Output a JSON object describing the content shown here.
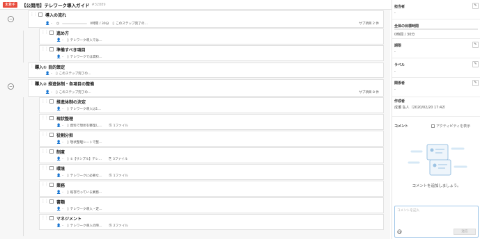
{
  "header": {
    "badge": "未着手",
    "title": "【公開用】テレワーク導入ガイド",
    "id": "#32889"
  },
  "task_rows": [
    {
      "title": "導入の流れ",
      "assignee": "-",
      "time": "0時間 / 30分",
      "desc": "このステップ完了の…",
      "files": "",
      "sub": "サブ項目 2 件"
    },
    {
      "title": "進め方",
      "assignee": "-",
      "time": "",
      "desc": "テレワーク導入では…",
      "files": "",
      "sub": ""
    },
    {
      "title": "準備すべき項目",
      "assignee": "-",
      "time": "",
      "desc": "テレワークでは資料…",
      "files": "",
      "sub": ""
    },
    {
      "title": "導入① 目的策定",
      "assignee": "-",
      "time": "",
      "desc": "このステップ完了の…",
      "files": "",
      "sub": ""
    },
    {
      "title": "導入② 推進体制・各項目の整備",
      "assignee": "-",
      "time": "",
      "desc": "このステップ完了の…",
      "files": "",
      "sub": "サブ項目 8 件"
    },
    {
      "title": "推進体制の決定",
      "assignee": "-",
      "time": "",
      "desc": "テレワーク導入は1…",
      "files": "",
      "sub": ""
    },
    {
      "title": "現状整理",
      "assignee": "-",
      "time": "",
      "desc": "資料で現状を整理し…",
      "files": "1ファイル",
      "sub": ""
    },
    {
      "title": "役割分担",
      "assignee": "-",
      "time": "",
      "desc": "現状整理シートで整…",
      "files": "",
      "sub": ""
    },
    {
      "title": "制度",
      "assignee": "-",
      "time": "",
      "desc": "①【サンプル】テレ…",
      "files": "3ファイル",
      "sub": ""
    },
    {
      "title": "環境",
      "assignee": "-",
      "time": "",
      "desc": "テレワークに必要な…",
      "files": "1ファイル",
      "sub": ""
    },
    {
      "title": "業務",
      "assignee": "-",
      "time": "",
      "desc": "既存行っている業務…",
      "files": "",
      "sub": ""
    },
    {
      "title": "書類",
      "assignee": "-",
      "time": "",
      "desc": "テレワーク導入・定…",
      "files": "",
      "sub": ""
    },
    {
      "title": "マネジメント",
      "assignee": "-",
      "time": "",
      "desc": "テレワーク導入の際…",
      "files": "2ファイル",
      "sub": ""
    }
  ],
  "sidebar": {
    "assignee_label": "担当者",
    "assignee_value": "-",
    "time_label": "全体の目標時間",
    "time_value": "0時間 / 30分",
    "deadline_label": "期限",
    "deadline_value": "-",
    "label_label": "ラベル",
    "label_value": "-",
    "related_label": "関係者",
    "related_value": "-",
    "creator_label": "作成者",
    "creator_value": "成瀬 弘人（2020/02/20 17:42）",
    "comment_label": "コメント",
    "activity_label": "アクティビティを表示",
    "empty_text": "コメントを追加しましょう。",
    "input_placeholder": "コメントを記入",
    "mention_symbol": "@",
    "send_label": "送信"
  }
}
